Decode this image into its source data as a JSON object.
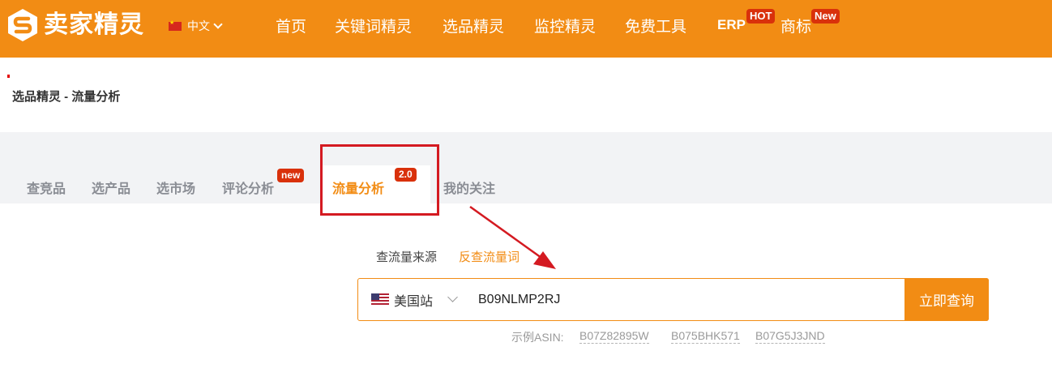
{
  "header": {
    "brand": "卖家精灵",
    "lang": "中文",
    "nav": [
      {
        "label": "首页"
      },
      {
        "label": "关键词精灵"
      },
      {
        "label": "选品精灵"
      },
      {
        "label": "监控精灵"
      },
      {
        "label": "免费工具"
      },
      {
        "label": "ERP",
        "badge": "HOT"
      },
      {
        "label": "商标",
        "badge": "New"
      }
    ],
    "bg_color": "#F28C14"
  },
  "breadcrumb": "选品精灵 - 流量分析",
  "tabs": [
    {
      "label": "查竞品"
    },
    {
      "label": "选产品"
    },
    {
      "label": "选市场"
    },
    {
      "label": "评论分析",
      "badge": "new"
    },
    {
      "label": "流量分析",
      "badge": "2.0",
      "active": true
    },
    {
      "label": "我的关注"
    }
  ],
  "subtabs": [
    {
      "label": "查流量来源"
    },
    {
      "label": "反查流量词",
      "active": true
    }
  ],
  "search": {
    "site": "美国站",
    "value": "B09NLMP2RJ",
    "button": "立即查询"
  },
  "examples": {
    "label": "示例ASIN:",
    "items": [
      "B07Z82895W",
      "B075BHK571",
      "B07G5J3JND"
    ]
  },
  "colors": {
    "accent": "#F28C14",
    "badge": "#d9310b",
    "annotation": "#d41a21"
  }
}
